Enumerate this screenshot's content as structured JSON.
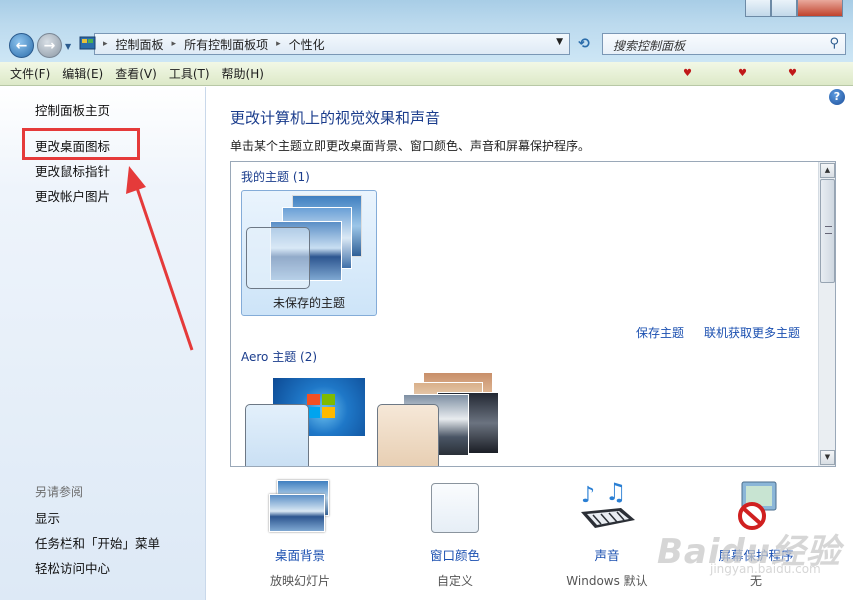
{
  "window": {
    "address": {
      "crumbs": [
        "控制面板",
        "所有控制面板项",
        "个性化"
      ]
    },
    "search": {
      "placeholder": "搜索控制面板",
      "icon": "search-icon"
    }
  },
  "menu": [
    "文件(F)",
    "编辑(E)",
    "查看(V)",
    "工具(T)",
    "帮助(H)"
  ],
  "sidebar": {
    "home": "控制面板主页",
    "links": [
      "更改桌面图标",
      "更改鼠标指针",
      "更改帐户图片"
    ],
    "see_also_header": "另请参阅",
    "see_also": [
      "显示",
      "任务栏和「开始」菜单",
      "轻松访问中心"
    ]
  },
  "main": {
    "title": "更改计算机上的视觉效果和声音",
    "description": "单击某个主题立即更改桌面背景、窗口颜色、声音和屏幕保护程序。",
    "my_themes_header": "我的主题 (1)",
    "unsaved_theme": "未保存的主题",
    "save_theme": "保存主题",
    "more_themes": "联机获取更多主题",
    "aero_header": "Aero 主题 (2)"
  },
  "bottom": [
    {
      "title": "桌面背景",
      "sub": "放映幻灯片",
      "icon": "desktop-background-icon"
    },
    {
      "title": "窗口颜色",
      "sub": "自定义",
      "icon": "window-color-icon"
    },
    {
      "title": "声音",
      "sub": "Windows 默认",
      "icon": "sound-icon"
    },
    {
      "title": "屏幕保护程序",
      "sub": "无",
      "icon": "screensaver-icon"
    }
  ],
  "watermark": {
    "logo": "Baidu经验",
    "url": "jingyan.baidu.com"
  },
  "colors": {
    "annotation_red": "#e53a3a",
    "link_blue": "#1a4fb0",
    "title_blue": "#1a3c8c"
  }
}
